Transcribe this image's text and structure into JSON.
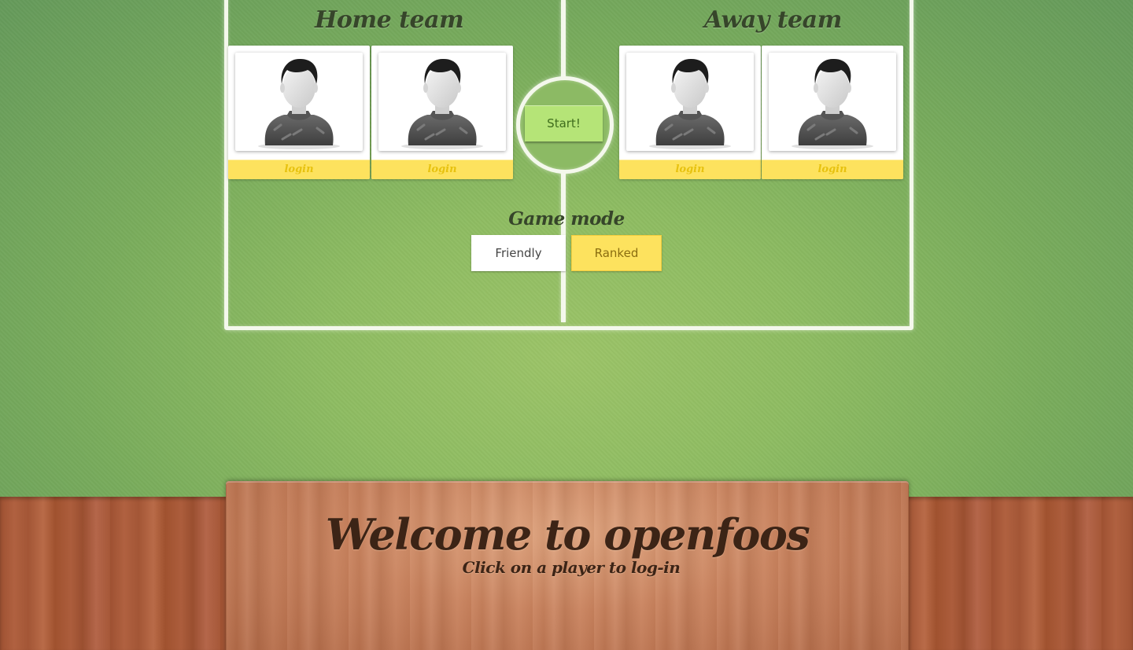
{
  "home_team": {
    "title": "Home team",
    "players": [
      {
        "login_label": "login"
      },
      {
        "login_label": "login"
      }
    ]
  },
  "away_team": {
    "title": "Away team",
    "players": [
      {
        "login_label": "login"
      },
      {
        "login_label": "login"
      }
    ]
  },
  "start_label": "Start!",
  "game_mode": {
    "title": "Game mode",
    "options": [
      "Friendly",
      "Ranked"
    ],
    "selected": "Ranked"
  },
  "welcome": {
    "title": "Welcome to openfoos",
    "subtitle": "Click on a player to log-in"
  },
  "icons": {
    "player_avatar": "user-silhouette-icon"
  },
  "colors": {
    "felt": "#8ebc62",
    "login_bar": "#fde25e",
    "start_button": "#b5e477",
    "wood": "#c9825d",
    "title_text": "#36452a"
  }
}
